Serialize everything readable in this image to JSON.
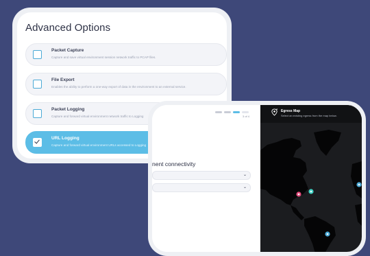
{
  "options": {
    "title": "Advanced Options",
    "items": [
      {
        "name": "Packet Capture",
        "desc": "Capture and save virtual environment session network traffic to PCAP files.",
        "checked": false
      },
      {
        "name": "File Export",
        "desc": "Enables the ability to perform a one-way export of data in the environment to an external service.",
        "checked": false
      },
      {
        "name": "Packet Logging",
        "desc": "Capture and forward virtual environment network traffic to Logging",
        "checked": false
      },
      {
        "name": "URL Logging",
        "desc": "Capture and forward virtual environment URLs accessed to Logging",
        "checked": true
      }
    ]
  },
  "wizard": {
    "step_count": "3 of 4",
    "connectivity_heading": "nent connectivity",
    "dropdown_chevron": "⌄",
    "map_title": "Egress Map",
    "map_subtitle": "Select an existing egress from the map below."
  },
  "colors": {
    "accent": "#5cbde6",
    "background": "#3e4879",
    "map_background": "#1b1c1f",
    "pin_teal": "#3fd1c4",
    "pin_pink": "#e04a7a",
    "pin_blue": "#4aa9d6"
  },
  "icons": {
    "checkbox": "checkbox-icon",
    "map_pin": "map-pin-icon",
    "chevron": "chevron-down-icon"
  }
}
